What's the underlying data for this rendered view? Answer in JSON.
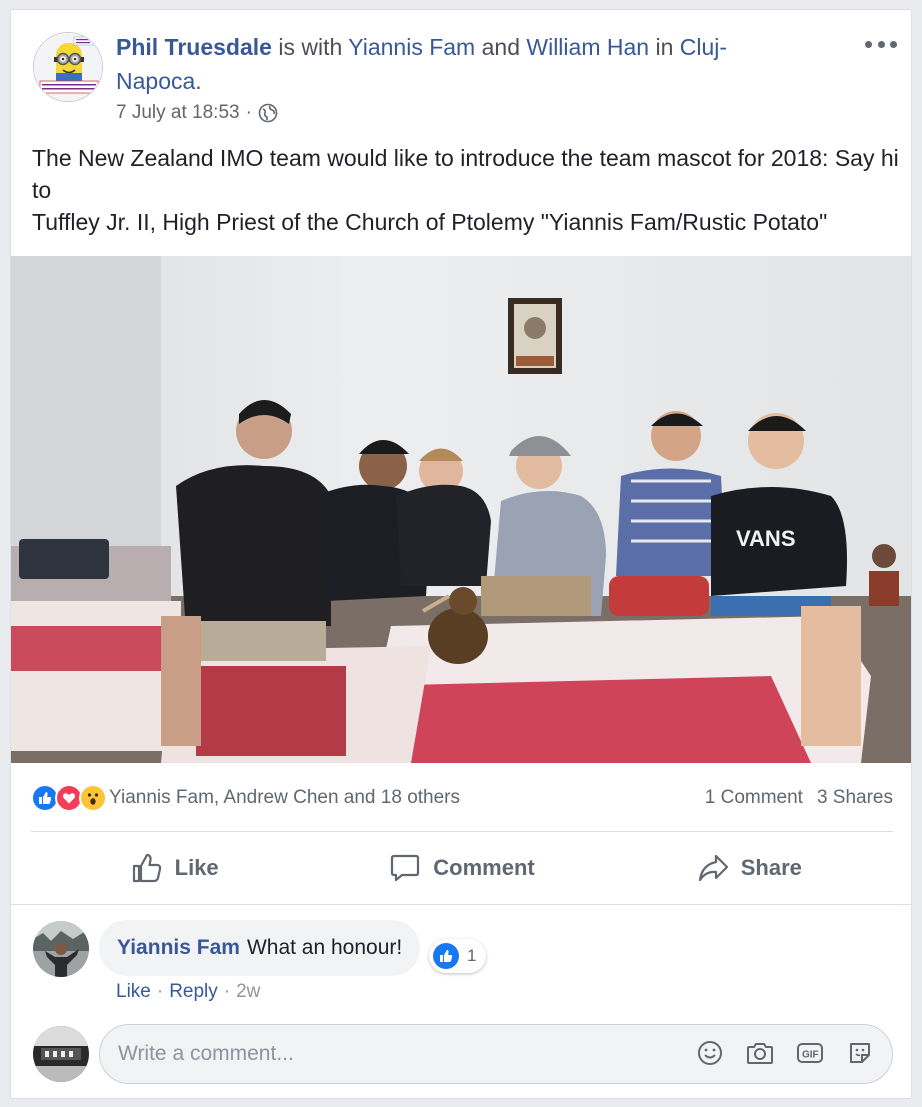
{
  "post": {
    "author": "Phil Truesdale",
    "with_text": "is with",
    "tag1": "Yiannis Fam",
    "and_text": "and",
    "tag2": "William Han",
    "in_text": "in",
    "location": "Cluj-Napoca",
    "period": ".",
    "timestamp": "7 July at 18:53",
    "separator": "·",
    "privacy_icon": "globe-icon",
    "text": "The New Zealand IMO team would like to introduce the team mascot for 2018: Say hi to\nTuffley Jr. II, High Priest of the Church of Ptolemy \"Yiannis Fam/Rustic Potato\"",
    "avatar_badge_text": "I support nurse healthcare"
  },
  "reactions": {
    "icons": [
      "like-icon",
      "love-icon",
      "wow-icon"
    ],
    "names": "Yiannis Fam, Andrew Chen and 18 others",
    "comments": "1 Comment",
    "shares": "3 Shares"
  },
  "actions": {
    "like": "Like",
    "comment": "Comment",
    "share": "Share"
  },
  "comment": {
    "author": "Yiannis Fam",
    "text": "What an honour!",
    "likes": "1",
    "like_label": "Like",
    "reply_label": "Reply",
    "dot": "·",
    "age": "2w"
  },
  "composer": {
    "placeholder": "Write a comment..."
  },
  "colors": {
    "link": "#385898",
    "like_blue": "#1877f2",
    "love_red": "#f33e58",
    "wow_yellow": "#fcc436"
  }
}
